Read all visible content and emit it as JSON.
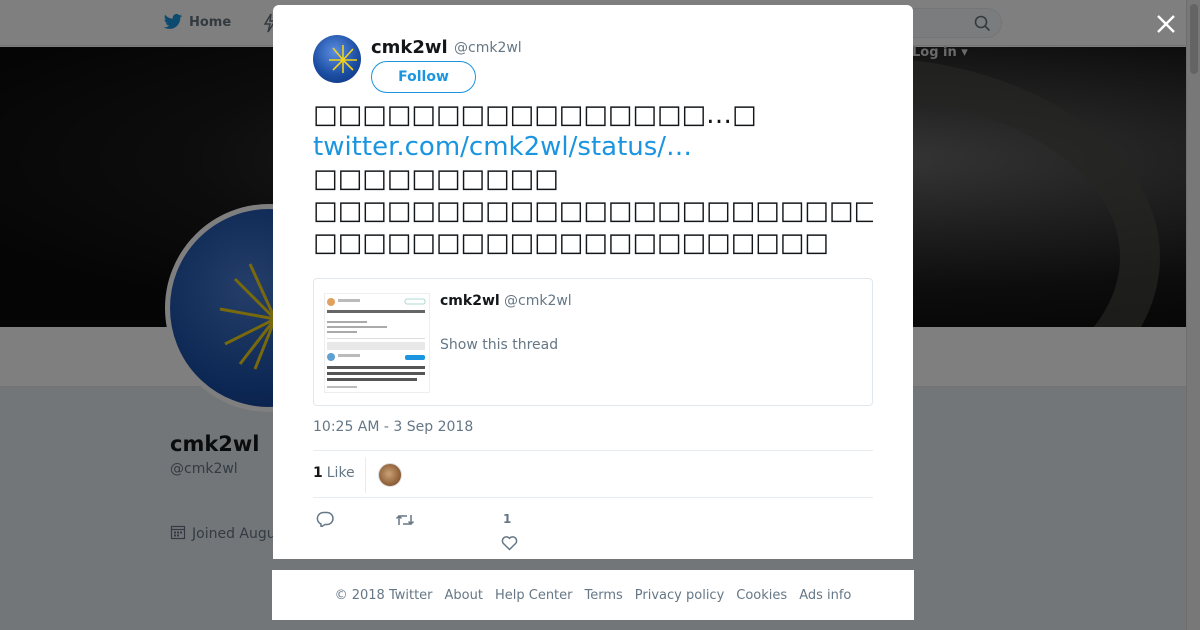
{
  "topbar": {
    "home_label": "Home",
    "login_label": "Log in ▾"
  },
  "profile": {
    "name": "cmk2wl",
    "handle": "@cmk2wl",
    "joined_label": "Joined Augu"
  },
  "tweet": {
    "author_name": "cmk2wl",
    "author_handle": "@cmk2wl",
    "follow_label": "Follow",
    "text_lines": [
      "□□□□□□□□□□□□□□□□…□",
      "□□□□□□□□□□",
      "□□□□□□□□□□□□□□□□□□□□□□□□□",
      "□□□□□□□□□□□□□□□□□□□□□"
    ],
    "link_text": "twitter.com/cmk2wl/status/…",
    "quote": {
      "author_name": "cmk2wl",
      "author_handle": "@cmk2wl",
      "thread_label": "Show this thread"
    },
    "timestamp": "10:25 AM - 3 Sep 2018",
    "likes_count": "1",
    "likes_label": "Like",
    "action_like_count": "1"
  },
  "footer": {
    "links": [
      "© 2018 Twitter",
      "About",
      "Help Center",
      "Terms",
      "Privacy policy",
      "Cookies",
      "Ads info"
    ]
  },
  "colors": {
    "brand_blue": "#1b95e0",
    "text_primary": "#14171a",
    "text_secondary": "#657786"
  }
}
